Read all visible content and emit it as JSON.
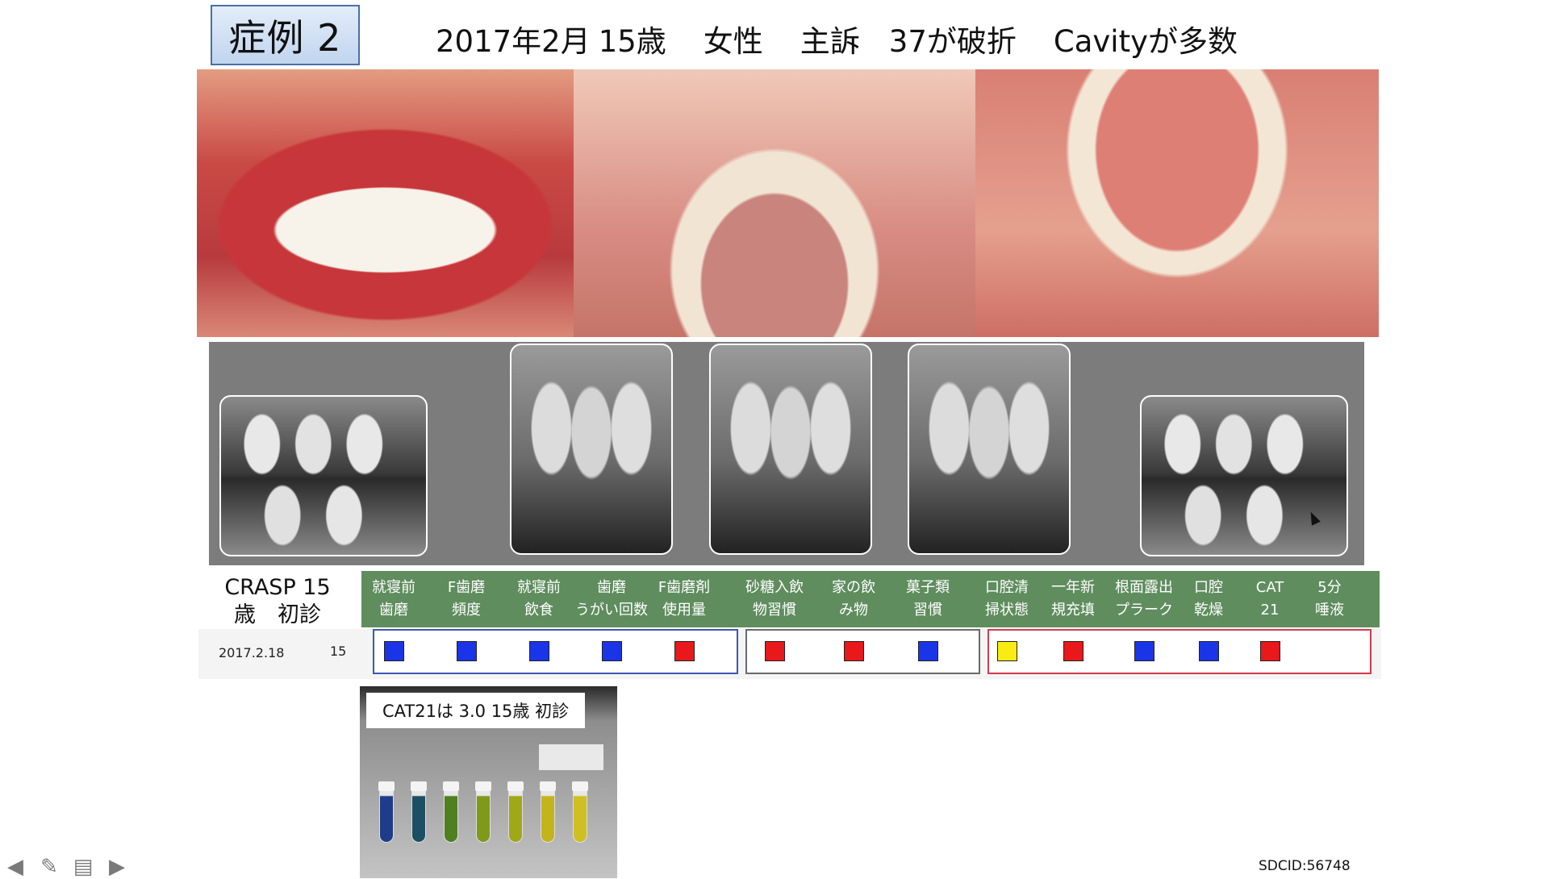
{
  "header": {
    "case_title": "症例 2",
    "date": "2017年2月",
    "age": "15歳",
    "sex": "女性",
    "complaint_label": "主訴",
    "complaint": "37が破折",
    "finding": "Cavityが多数"
  },
  "crasp": {
    "title": "CRASP 15\n歳　初診",
    "date": "2017.2.18",
    "age": "15",
    "columns": [
      {
        "label": "就寝前\n歯磨",
        "status": "blue"
      },
      {
        "label": "F歯磨\n頻度",
        "status": "blue"
      },
      {
        "label": "就寝前\n飲食",
        "status": "blue"
      },
      {
        "label": "歯磨\nうがい回数",
        "status": "blue"
      },
      {
        "label": "F歯磨剤\n使用量",
        "status": "red"
      },
      {
        "label": "砂糖入飲\n物習慣",
        "status": "red"
      },
      {
        "label": "家の飲\nみ物",
        "status": "red"
      },
      {
        "label": "菓子類\n習慣",
        "status": "blue"
      },
      {
        "label": "口腔清\n掃状態",
        "status": "yellow"
      },
      {
        "label": "一年新\n規充填",
        "status": "red"
      },
      {
        "label": "根面露出\nプラーク",
        "status": "blue"
      },
      {
        "label": "口腔\n乾燥",
        "status": "blue"
      },
      {
        "label": "CAT\n21",
        "status": "red"
      },
      {
        "label": "5分\n唾液",
        "status": null
      }
    ],
    "colors": {
      "blue": "#1a35e8",
      "red": "#e8181b",
      "yellow": "#f8ec12",
      "header": "#5f8d5e"
    }
  },
  "cat": {
    "label": "CAT21は 3.0 15歳 初診"
  },
  "footer": {
    "sdcid": "SDCID:56748"
  },
  "nav": {
    "icons": [
      "arrow-left-icon",
      "pencil-icon",
      "menu-icon",
      "arrow-right-icon"
    ]
  }
}
